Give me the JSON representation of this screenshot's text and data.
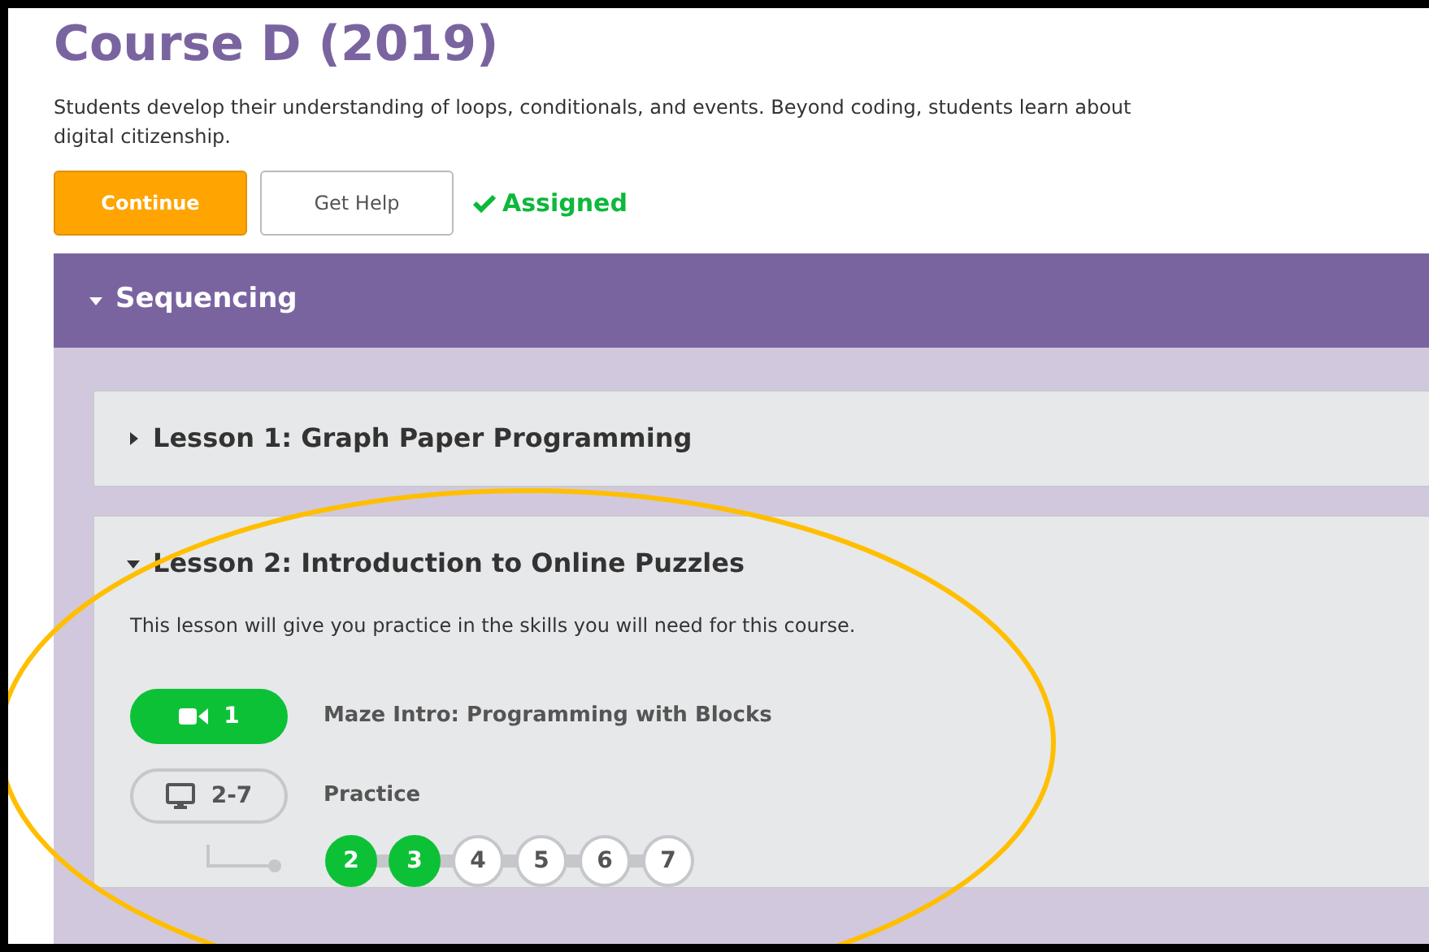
{
  "course": {
    "title": "Course D (2019)",
    "description": "Students develop their understanding of loops, conditionals, and events. Beyond coding, students learn about digital citizenship.",
    "buttons": [
      {
        "label": "Continue",
        "kind": "primary"
      },
      {
        "label": "Get Help",
        "kind": "secondary"
      }
    ],
    "status": "Assigned"
  },
  "section": {
    "title": "Sequencing",
    "expanded": true,
    "lessons": [
      {
        "title": "Lesson 1: Graph Paper Programming",
        "expanded": false
      },
      {
        "title": "Lesson 2: Introduction to Online Puzzles",
        "expanded": true,
        "description": "This lesson will give you practice in the skills you will need for this course.",
        "activities": [
          {
            "kind": "video",
            "range": "1",
            "name": "Maze Intro: Programming with Blocks",
            "completed": true
          },
          {
            "kind": "practice",
            "range": "2-7",
            "name": "Practice",
            "completed": false,
            "levels": [
              {
                "label": "2",
                "completed": true
              },
              {
                "label": "3",
                "completed": true
              },
              {
                "label": "4",
                "completed": false
              },
              {
                "label": "5",
                "completed": false
              },
              {
                "label": "6",
                "completed": false
              },
              {
                "label": "7",
                "completed": false
              }
            ]
          }
        ]
      }
    ]
  }
}
